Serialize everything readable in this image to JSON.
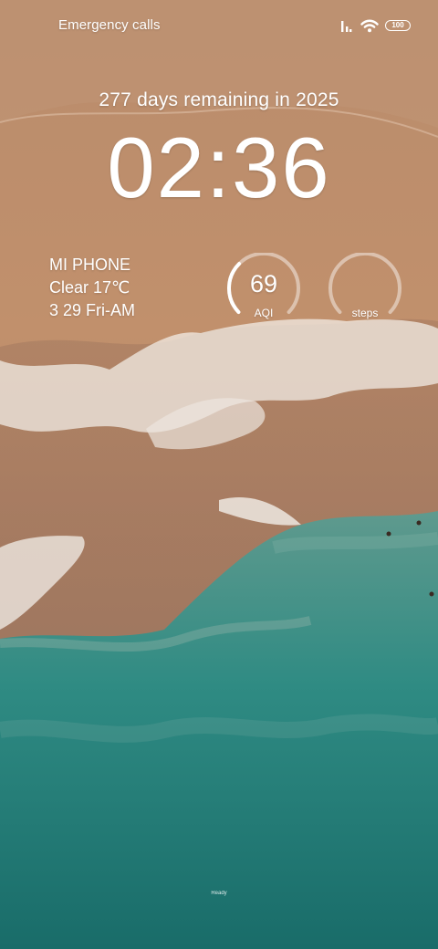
{
  "status_bar": {
    "carrier_text": "Emergency calls",
    "battery_level": "100",
    "icons": [
      "signal-icon",
      "wifi-icon",
      "battery-icon"
    ]
  },
  "lockscreen": {
    "year_progress": "277 days remaining in 2025",
    "time": "02:36",
    "device_name": "MI PHONE",
    "weather": "Clear 17℃",
    "date": "3 29 Fri-AM"
  },
  "widgets": {
    "aqi": {
      "value": "69",
      "label": "AQI",
      "fill_fraction": 0.33
    },
    "steps": {
      "label": "steps",
      "fill_fraction": 0.0
    }
  },
  "home_indicator_text": "Ready",
  "colors": {
    "text": "#ffffff",
    "sand": "#b98a68",
    "sea": "#2a8c86"
  }
}
